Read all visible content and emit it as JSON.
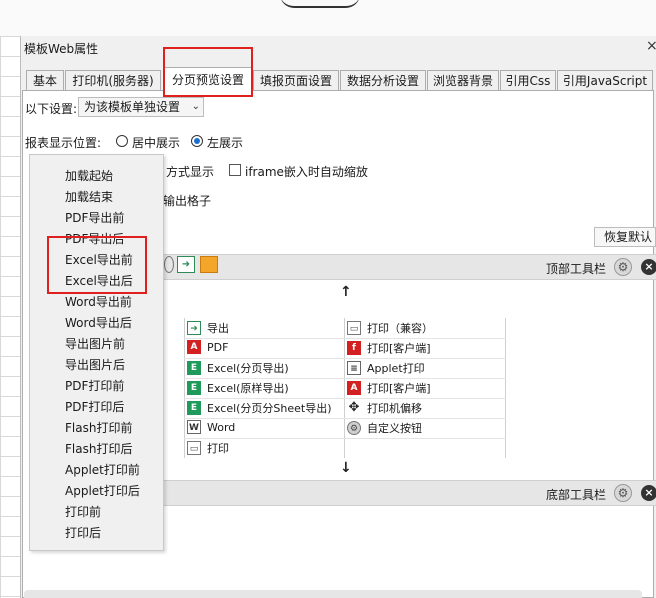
{
  "dialog": {
    "title": "模板Web属性",
    "close": "×"
  },
  "tabs": [
    "基本",
    "打印机(服务器)",
    "分页预览设置",
    "填报页面设置",
    "数据分析设置",
    "浏览器背景",
    "引用Css",
    "引用JavaScript"
  ],
  "settings": {
    "below_label": "以下设置:",
    "below_value": "为该模板单独设置",
    "position_label": "报表显示位置:",
    "radio_center": "居中展示",
    "radio_left": "左展示",
    "display_mode_partial": "方式显示",
    "iframe_label": "iframe嵌入时自动缩放",
    "output_partial": "输出格子",
    "restore_button": "恢复默认"
  },
  "toolbars": {
    "top": "顶部工具栏",
    "bottom": "底部工具栏",
    "up_arrow": "↑",
    "down_arrow": "↓"
  },
  "items_left": [
    "导出",
    "PDF",
    "Excel(分页导出)",
    "Excel(原样导出)",
    "Excel(分页分Sheet导出)",
    "Word",
    "打印"
  ],
  "items_right": [
    "打印（兼容）",
    "打印[客户端]",
    "Applet打印",
    "打印[客户端]",
    "打印机偏移",
    "自定义按钮"
  ],
  "menu_items": [
    "加载起始",
    "加载结束",
    "PDF导出前",
    "PDF导出后",
    "Excel导出前",
    "Excel导出后",
    "Word导出前",
    "Word导出后",
    "导出图片前",
    "导出图片后",
    "PDF打印前",
    "PDF打印后",
    "Flash打印前",
    "Flash打印后",
    "Applet打印前",
    "Applet打印后",
    "打印前",
    "打印后"
  ],
  "colors": {
    "highlight_box": "#e0201e",
    "accent_blue": "#1a6fd0",
    "excel_green": "#1f9a5a",
    "pdf_red": "#d32020"
  }
}
